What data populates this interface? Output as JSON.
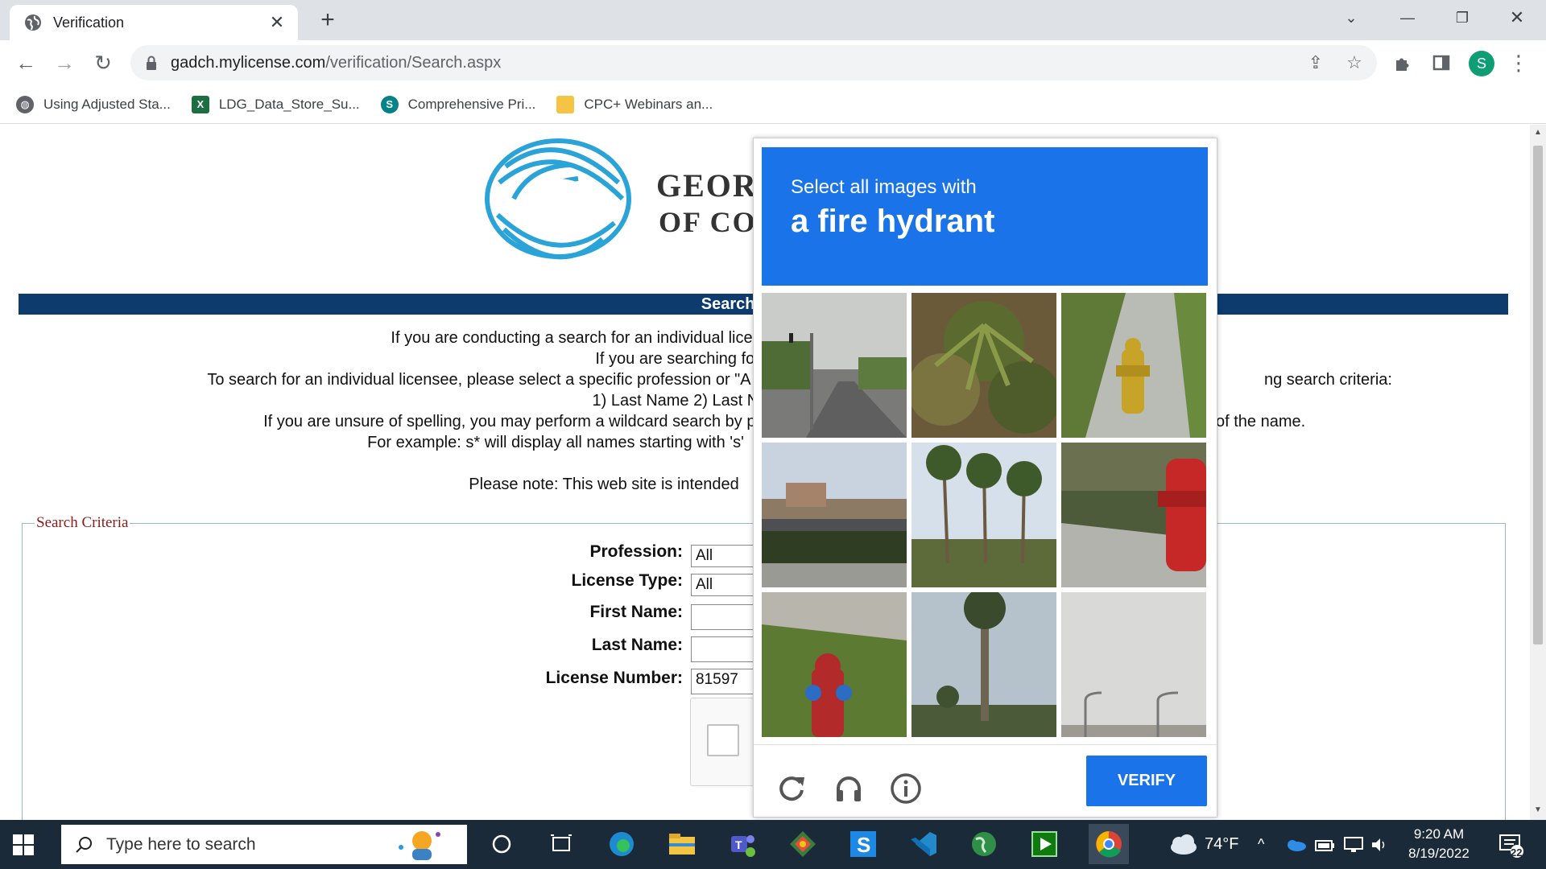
{
  "browser": {
    "tab_title": "Verification",
    "new_tab": "+",
    "url_domain": "gadch.mylicense.com",
    "url_path": "/verification/Search.aspx",
    "avatar_letter": "S",
    "bookmarks": [
      {
        "label": "Using Adjusted Sta...",
        "icon": "globe-icon"
      },
      {
        "label": "LDG_Data_Store_Su...",
        "icon": "excel-icon"
      },
      {
        "label": "Comprehensive Pri...",
        "icon": "sharepoint-icon"
      },
      {
        "label": "CPC+ Webinars an...",
        "icon": "folder-icon"
      }
    ]
  },
  "page": {
    "logo_line1": "GEOR",
    "logo_line2": "OF CO",
    "banner": "Search for a Pro",
    "instructions": [
      "If you are conducting a search for an individual lice",
      "If you are searching for a",
      "To search for an individual licensee, please select a specific profession or \"A",
      "1) Last Name 2) Last Name ar",
      "If you are unsure of spelling, you may perform a wildcard search by pl",
      "For example: s* will display all names starting with 's'",
      "Please note: This web site is intended"
    ],
    "instructions_right": {
      "line3_tail": "ng search criteria:",
      "line5_tail": "of the name."
    },
    "search_criteria_legend": "Search Criteria",
    "fields": {
      "profession_label": "Profession:",
      "profession_value": "All",
      "license_type_label": "License Type:",
      "license_type_value": "All",
      "first_name_label": "First Name:",
      "first_name_value": "",
      "last_name_label": "Last Name:",
      "last_name_value": "",
      "license_number_label": "License Number:",
      "license_number_value": "81597"
    }
  },
  "captcha": {
    "prompt_line1": "Select all images with",
    "prompt_line2": "a fire hydrant",
    "verify_label": "VERIFY",
    "colors": {
      "header": "#1a73e8"
    }
  },
  "taskbar": {
    "search_placeholder": "Type here to search",
    "weather": "74°F",
    "time": "9:20 AM",
    "date": "8/19/2022",
    "notifications": "22"
  }
}
